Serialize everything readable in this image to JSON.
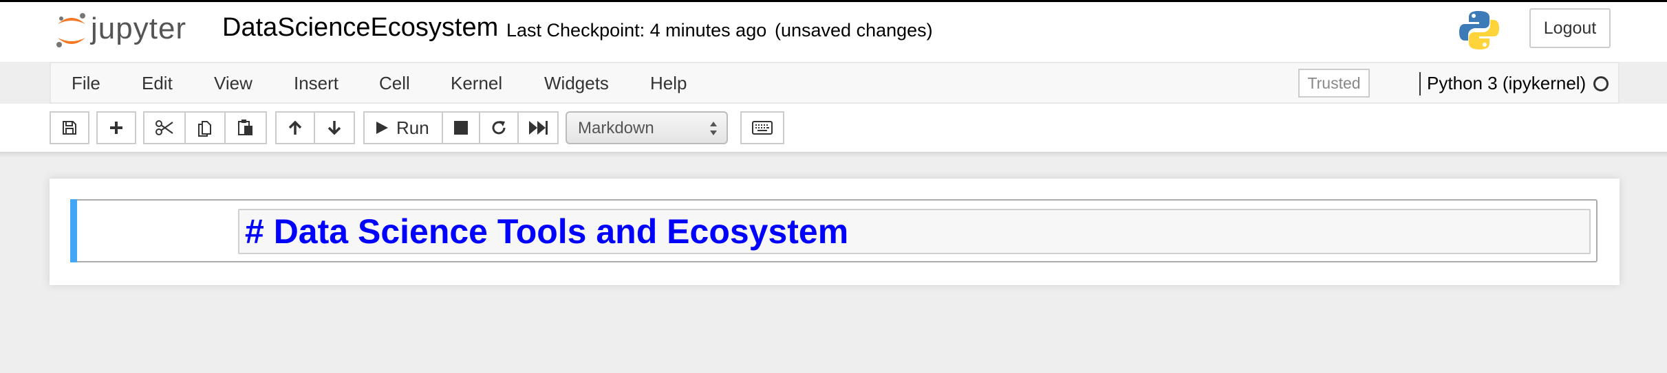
{
  "header": {
    "logo_text": "jupyter",
    "notebook_title": "DataScienceEcosystem",
    "checkpoint": "Last Checkpoint: 4 minutes ago",
    "save_status": "(unsaved changes)",
    "logout_label": "Logout"
  },
  "menubar": {
    "items": [
      "File",
      "Edit",
      "View",
      "Insert",
      "Cell",
      "Kernel",
      "Widgets",
      "Help"
    ],
    "trusted_label": "Trusted",
    "kernel_name": "Python 3 (ipykernel)"
  },
  "toolbar": {
    "run_label": "Run",
    "cell_type": "Markdown",
    "icons": [
      "save-icon",
      "plus-icon",
      "scissors-icon",
      "copy-icon",
      "paste-icon",
      "arrow-up-icon",
      "arrow-down-icon",
      "play-icon",
      "stop-icon",
      "restart-icon",
      "fast-forward-icon",
      "keyboard-icon"
    ]
  },
  "cell": {
    "source": "# Data Science Tools and Ecosystem"
  },
  "colors": {
    "accent_selected_cell": "#42a5f5",
    "heading_text": "#0000ff",
    "jupyter_orange": "#f37726"
  }
}
